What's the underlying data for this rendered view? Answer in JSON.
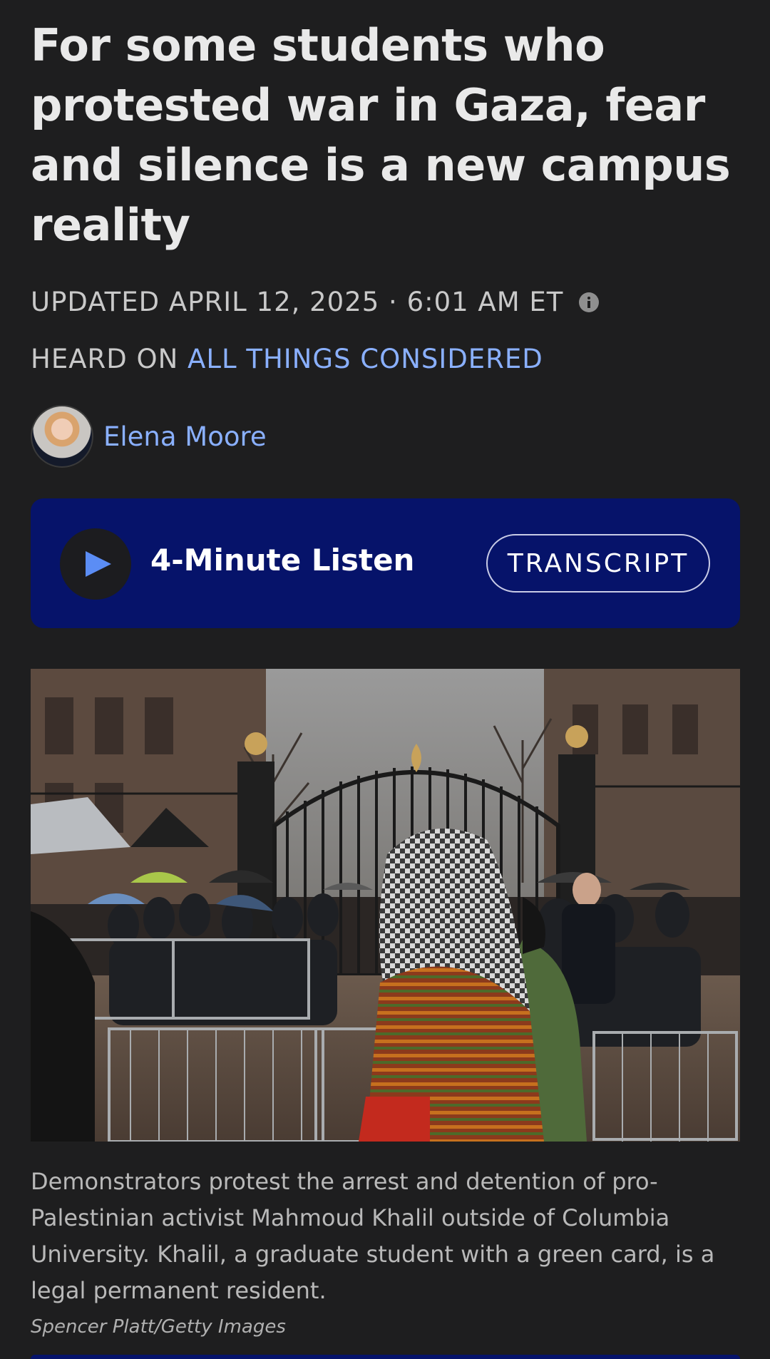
{
  "article": {
    "headline": "For some students who protested war in Gaza, fear and silence is a new campus reality",
    "updated": "UPDATED APRIL 12, 2025 · 6:01 AM ET",
    "info_icon": "info-circle-icon",
    "heard_on_prefix": "HEARD ON",
    "program": "ALL THINGS CONSIDERED",
    "author": "Elena Moore"
  },
  "audio": {
    "play_icon": "play-icon",
    "listen_label": "4-Minute Listen",
    "transcript_label": "TRANSCRIPT"
  },
  "photo": {
    "caption": "Demonstrators protest the arrest and detention of pro-Palestinian activist Mahmoud Khalil outside of Columbia University. Khalil, a graduate student with a green card, is a legal permanent resident.",
    "credit": "Spencer Platt/Getty Images"
  },
  "colors": {
    "background": "#1e1e1f",
    "link": "#8ab0ff",
    "audio_bar": "#06136a",
    "play_accent": "#5b8df5"
  }
}
